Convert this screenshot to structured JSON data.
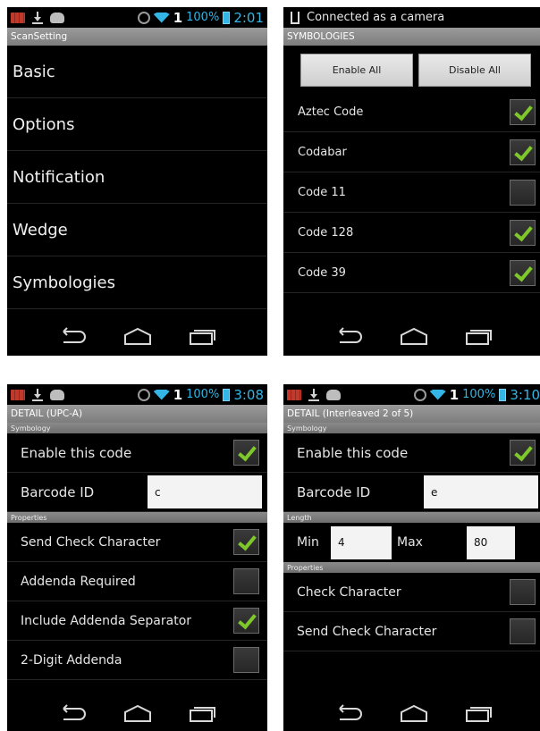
{
  "status": {
    "signal": "1",
    "battery": "100%",
    "times": [
      "2:01",
      "3:08",
      "3:10"
    ],
    "usb_text": "Connected as a camera"
  },
  "screen1": {
    "title": "ScanSetting",
    "items": [
      "Basic",
      "Options",
      "Notification",
      "Wedge",
      "Symbologies"
    ]
  },
  "screen2": {
    "title": "SYMBOLOGIES",
    "enable_all": "Enable All",
    "disable_all": "Disable All",
    "items": [
      {
        "label": "Aztec Code",
        "checked": true
      },
      {
        "label": "Codabar",
        "checked": true
      },
      {
        "label": "Code 11",
        "checked": false
      },
      {
        "label": "Code 128",
        "checked": true
      },
      {
        "label": "Code 39",
        "checked": true
      }
    ]
  },
  "screen3": {
    "title": "DETAIL (UPC-A)",
    "section_symbology": "Symbology",
    "enable_label": "Enable this code",
    "enable_checked": true,
    "barcode_id_label": "Barcode ID",
    "barcode_id_value": "c",
    "section_properties": "Properties",
    "properties": [
      {
        "label": "Send Check Character",
        "checked": true
      },
      {
        "label": "Addenda Required",
        "checked": false
      },
      {
        "label": "Include Addenda Separator",
        "checked": true
      },
      {
        "label": "2-Digit Addenda",
        "checked": false
      }
    ]
  },
  "screen4": {
    "title": "DETAIL (Interleaved 2 of 5)",
    "section_symbology": "Symbology",
    "enable_label": "Enable this code",
    "enable_checked": true,
    "barcode_id_label": "Barcode ID",
    "barcode_id_value": "e",
    "section_length": "Length",
    "min_label": "Min",
    "min_value": "4",
    "max_label": "Max",
    "max_value": "80",
    "section_properties": "Properties",
    "properties": [
      {
        "label": "Check Character",
        "checked": false
      },
      {
        "label": "Send Check Character",
        "checked": false
      }
    ]
  }
}
